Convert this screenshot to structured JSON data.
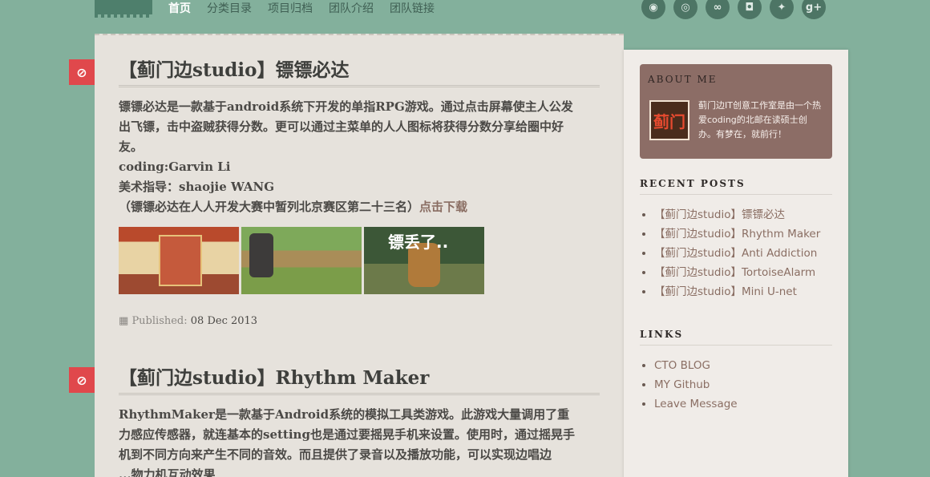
{
  "nav": {
    "items": [
      "首页",
      "分类目录",
      "项目归档",
      "团队介绍",
      "团队链接"
    ]
  },
  "social": {
    "icons": [
      "rss-icon",
      "weibo-icon",
      "renren-icon",
      "github-icon",
      "twitter-icon",
      "google-plus-icon"
    ],
    "glyphs": [
      "◉",
      "◎",
      "∞",
      "◘",
      "✦",
      "g+"
    ]
  },
  "posts": [
    {
      "title": "【蓟门边studio】镖镖必达",
      "body_lines": [
        "镖镖必达是一款基于android系统下开发的单指RPG游戏。通过点击屏幕使主人公发",
        "出飞镖，击中盗贼获得分数。更可以通过主菜单的人人图标将获得分数分享给圈中好",
        "友。",
        "coding:Garvin Li",
        "美术指导：shaojie WANG"
      ],
      "note": "（镖镖必达在人人开发大赛中暂列北京赛区第二十三名）",
      "download": "点击下载",
      "thumb3_text": "镖丢了..",
      "published_label": "Published:",
      "published_date": "08 Dec 2013"
    },
    {
      "title": "【蓟门边studio】Rhythm Maker",
      "body_lines": [
        "RhythmMaker是一款基于Android系统的模拟工具类游戏。此游戏大量调用了重",
        "力感应传感器，就连基本的setting也是通过要摇晃手机来设置。使用时，通过摇晃手",
        "机到不同方向来产生不同的音效。而且提供了录音以及播放功能，可以实现边唱边",
        "...物力机互动效果"
      ]
    }
  ],
  "sidebar": {
    "about_title": "ABOUT ME",
    "about_text": "蓟门边IT创意工作室是由一个热爱coding的北邮在读硕士创办。有梦在，就前行！",
    "avatar_text": "蓟门",
    "recent_title": "RECENT POSTS",
    "recent": [
      "【蓟门边studio】镖镖必达",
      "【蓟门边studio】Rhythm Maker",
      "【蓟门边studio】Anti Addiction",
      "【蓟门边studio】TortoiseAlarm",
      "【蓟门边studio】Mini U-net"
    ],
    "links_title": "LINKS",
    "links": [
      "CTO BLOG",
      "MY Github",
      "Leave Message"
    ]
  },
  "colors": {
    "background": "#83b09c",
    "accent_badge": "#e0484c",
    "about_box": "#8c6d66",
    "link": "#8a6e63"
  }
}
